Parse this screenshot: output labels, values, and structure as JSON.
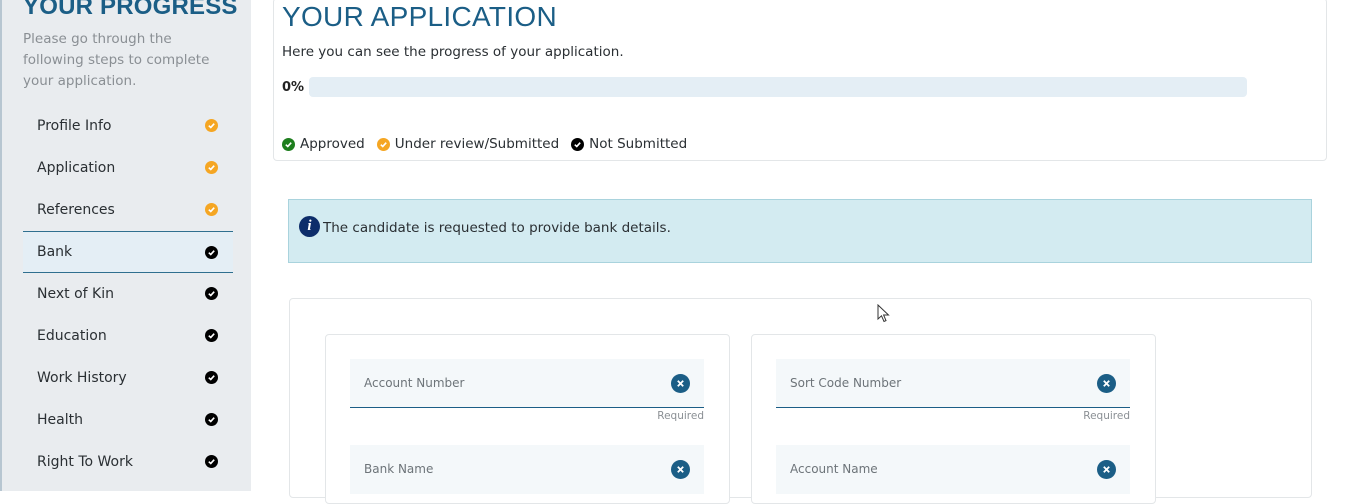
{
  "sidebar": {
    "title": "YOUR PROGRESS",
    "description": "Please go through the following steps to complete your application.",
    "steps": [
      {
        "label": "Profile Info",
        "status": "submitted"
      },
      {
        "label": "Application",
        "status": "submitted"
      },
      {
        "label": "References",
        "status": "submitted"
      },
      {
        "label": "Bank",
        "status": "not-submitted"
      },
      {
        "label": "Next of Kin",
        "status": "not-submitted"
      },
      {
        "label": "Education",
        "status": "not-submitted"
      },
      {
        "label": "Work History",
        "status": "not-submitted"
      },
      {
        "label": "Health",
        "status": "not-submitted"
      },
      {
        "label": "Right To Work",
        "status": "not-submitted"
      }
    ],
    "active_step": "Bank"
  },
  "application": {
    "title": "YOUR APPLICATION",
    "subtitle": "Here you can see the progress of your application.",
    "progress_label": "0%",
    "progress_value": 0
  },
  "legend": {
    "approved": "Approved",
    "under_review": "Under review/Submitted",
    "not_submitted": "Not Submitted"
  },
  "info": {
    "icon": "info-icon",
    "text": "The candidate is requested to provide bank details."
  },
  "form": {
    "account_number": {
      "placeholder": "Account Number",
      "value": "",
      "hint": "Required"
    },
    "sort_code": {
      "placeholder": "Sort Code Number",
      "value": "",
      "hint": "Required"
    },
    "bank_name": {
      "placeholder": "Bank Name",
      "value": ""
    },
    "account_name": {
      "placeholder": "Account Name",
      "value": ""
    }
  },
  "colors": {
    "primary": "#1b5e86",
    "approved": "#1e7e1e",
    "under_review": "#f5a623",
    "not_submitted": "#000000",
    "info_bg": "#d3ebf1"
  }
}
